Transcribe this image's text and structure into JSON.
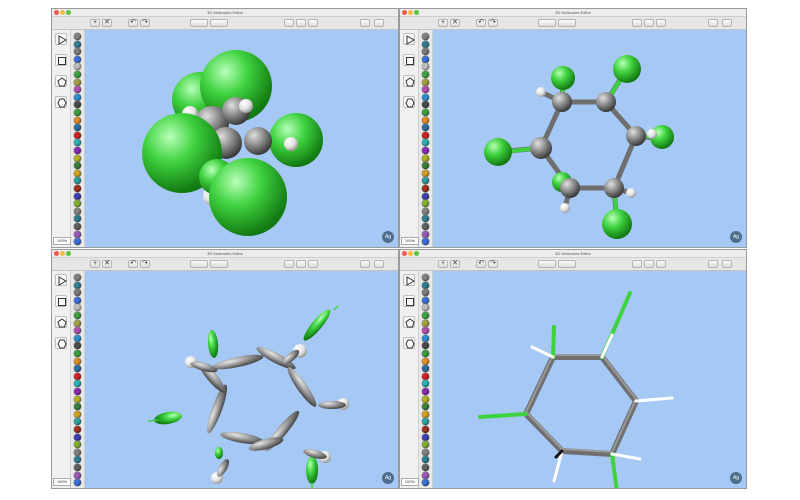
{
  "windows": [
    {
      "title": "3D Molecules Editor",
      "zoom": "100%",
      "badge": "Ag",
      "render_mode": "space-filling",
      "molecule": "hexachlorocyclohexane"
    },
    {
      "title": "3D Molecules Editor",
      "zoom": "100%",
      "badge": "Ag",
      "render_mode": "ball-and-stick",
      "molecule": "hexachlorocyclohexane"
    },
    {
      "title": "3D Molecules Editor",
      "zoom": "100%",
      "badge": "Ag",
      "render_mode": "orbitals",
      "molecule": "hexachlorocyclohexane"
    },
    {
      "title": "3D Molecules Editor",
      "zoom": "100%",
      "badge": "Ag",
      "render_mode": "sticks",
      "molecule": "hexachlorocyclohexane"
    }
  ],
  "toolbar": {
    "add": "+",
    "delete": "✕",
    "undo": "↶",
    "redo": "↷"
  },
  "tools": [
    "play-icon",
    "square-icon",
    "pentagon-icon",
    "hexagon-icon"
  ],
  "colors": {
    "background": "#a6c8f4",
    "carbon": "#8e8e8e",
    "chlorine": "#3fd23f",
    "hydrogen": "#f2f2f2"
  },
  "palette": [
    "#808080",
    "#2f7d8f",
    "#7a7a7a",
    "#3a6fd8",
    "#bcbcbc",
    "#3fa03f",
    "#a0a040",
    "#b04fb0",
    "#2b8fcf",
    "#4a4a4a",
    "#3a9f3a",
    "#e08a20",
    "#2a6fa0",
    "#d02020",
    "#2ab0b0",
    "#8a2ab0",
    "#b0b020",
    "#3a7f3a",
    "#d0a020",
    "#2f9f9f",
    "#a03020",
    "#3f3fb0",
    "#7faf2f",
    "#808080",
    "#2f7d8f",
    "#606060",
    "#9b59b6",
    "#3a6fd8"
  ]
}
